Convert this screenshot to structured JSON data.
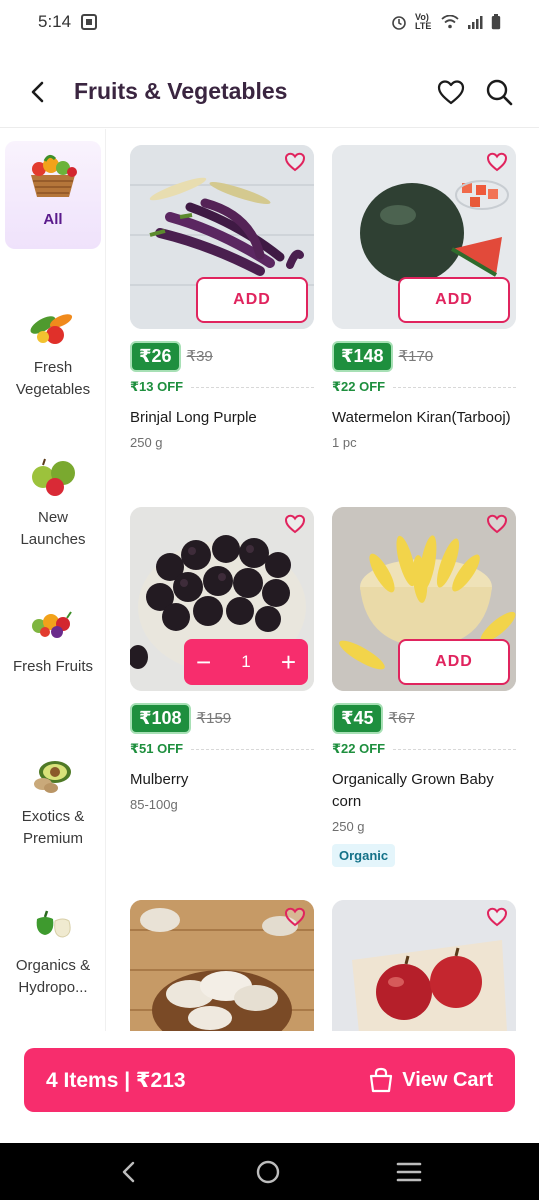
{
  "status": {
    "time": "5:14",
    "network": "Vo) LTE"
  },
  "header": {
    "title": "Fruits & Vegetables"
  },
  "sidebar": {
    "items": [
      {
        "label": "All",
        "active": true
      },
      {
        "label": "Fresh Vegetables",
        "active": false
      },
      {
        "label": "New Launches",
        "active": false
      },
      {
        "label": "Fresh Fruits",
        "active": false
      },
      {
        "label": "Exotics & Premium",
        "active": false
      },
      {
        "label": "Organics & Hydropo...",
        "active": false
      }
    ]
  },
  "products": [
    {
      "name": "Brinjal Long Purple",
      "price": "₹26",
      "mrp": "₹39",
      "off": "₹13 OFF",
      "qty": "250 g",
      "action": "ADD"
    },
    {
      "name": "Watermelon Kiran(Tarbooj)",
      "price": "₹148",
      "mrp": "₹170",
      "off": "₹22 OFF",
      "qty": "1 pc",
      "action": "ADD"
    },
    {
      "name": "Mulberry",
      "price": "₹108",
      "mrp": "₹159",
      "off": "₹51 OFF",
      "qty": "85-100g",
      "count": "1"
    },
    {
      "name": "Organically Grown Baby corn",
      "price": "₹45",
      "mrp": "₹67",
      "off": "₹22 OFF",
      "qty": "250 g",
      "tag": "Organic",
      "action": "ADD"
    },
    {
      "name": "",
      "image": "mushrooms"
    },
    {
      "name": "",
      "image": "apples"
    }
  ],
  "cart": {
    "summary": "4 Items | ₹213",
    "button": "View Cart"
  },
  "colors": {
    "brand": "#f72d6d",
    "add_border": "#e0245e",
    "price_green": "#1e8f3e",
    "title": "#3a2540",
    "active_category": "#5a1a8c"
  },
  "icons": [
    "back-arrow-icon",
    "heart-icon",
    "search-icon",
    "bag-icon",
    "nav-back-icon",
    "nav-home-icon",
    "nav-menu-icon"
  ]
}
